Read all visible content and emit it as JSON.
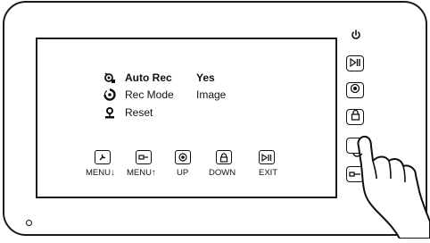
{
  "menu": {
    "items": [
      {
        "label": "Auto Rec",
        "value": "Yes",
        "icon": "auto-rec-icon",
        "bold": true
      },
      {
        "label": "Rec Mode",
        "value": "Image",
        "icon": "rec-mode-icon",
        "bold": false
      },
      {
        "label": "Reset",
        "value": "",
        "icon": "reset-icon",
        "bold": false
      }
    ]
  },
  "keys": [
    {
      "label": "MENU↓",
      "icon": "wrench-icon"
    },
    {
      "label": "MENU↑",
      "icon": "key-icon"
    },
    {
      "label": "UP",
      "icon": "target-icon"
    },
    {
      "label": "DOWN",
      "icon": "lock-icon"
    },
    {
      "label": "EXIT",
      "icon": "play-pause-icon"
    }
  ],
  "side_buttons": [
    {
      "icon": "play-pause-icon"
    },
    {
      "icon": "target-icon"
    },
    {
      "icon": "lock-icon"
    },
    {
      "icon": "blank-icon"
    },
    {
      "icon": "key-icon"
    }
  ],
  "colors": {
    "outline": "#111111",
    "background": "#ffffff"
  }
}
